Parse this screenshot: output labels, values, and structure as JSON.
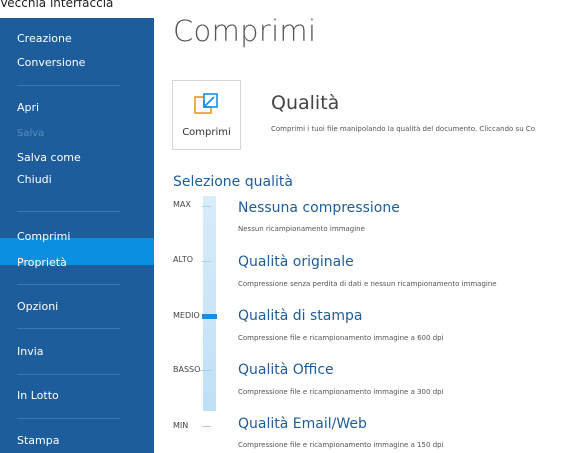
{
  "window": {
    "title": "Vecchia interfaccia"
  },
  "sidebar": {
    "items": [
      {
        "label": "Creazione"
      },
      {
        "label": "Conversione"
      },
      {
        "label": "Apri"
      },
      {
        "label": "Salva"
      },
      {
        "label": "Salva come"
      },
      {
        "label": "Chiudi"
      },
      {
        "label": "Comprimi"
      },
      {
        "label": "Proprietà"
      },
      {
        "label": "Opzioni"
      },
      {
        "label": "Invia"
      },
      {
        "label": "In Lotto"
      },
      {
        "label": "Stampa"
      }
    ],
    "selected": "Comprimi",
    "disabled": "Salva"
  },
  "page": {
    "title": "Comprimi"
  },
  "quality_button": {
    "label": "Comprimi",
    "icon": "compress-icon"
  },
  "quality_section": {
    "title": "Qualità",
    "description": "Comprimi i tuoi file manipolando la qualità del documento. Cliccando su Co"
  },
  "selection": {
    "title": "Selezione qualità",
    "levels": [
      "MAX",
      "ALTO",
      "MEDIO",
      "BASSO",
      "MIN"
    ],
    "current_level": "MEDIO",
    "options": [
      {
        "title": "Nessuna compressione",
        "desc": "Nessun ricampionamento immagine"
      },
      {
        "title": "Qualità originale",
        "desc": "Compressione senza perdita di dati e nessun ricampionamento immagine"
      },
      {
        "title": "Qualità di stampa",
        "desc": "Compressione file e ricampionamento immagine a 600 dpi"
      },
      {
        "title": "Qualità Office",
        "desc": "Compressione file e ricampionamento immagine a 300 dpi"
      },
      {
        "title": "Qualità Email/Web",
        "desc": "Compressione file e ricampionamento immagine a 150 dpi"
      }
    ]
  },
  "colors": {
    "sidebar": "#1d5d9b",
    "sidebar_selected": "#0a90e0",
    "accent_text": "#1d5d9b",
    "slider_thumb": "#1a8ee0"
  }
}
